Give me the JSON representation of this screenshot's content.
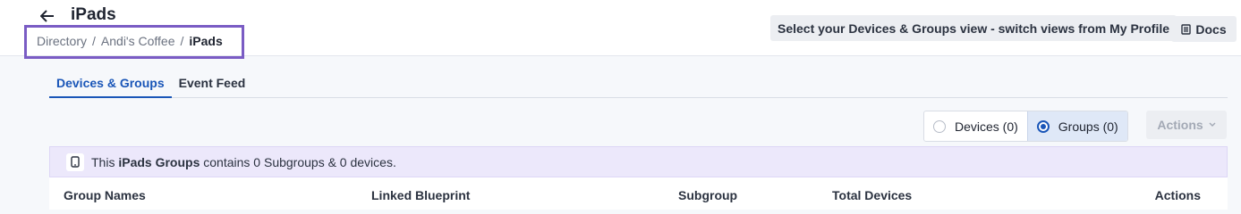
{
  "header": {
    "title": "iPads",
    "breadcrumb": [
      "Directory",
      "Andi's Coffee",
      "iPads"
    ],
    "view_hint": "Select your Devices & Groups view - switch views from My Profile",
    "docs_label": "Docs"
  },
  "tabs": [
    {
      "label": "Devices & Groups",
      "active": true
    },
    {
      "label": "Event Feed",
      "active": false
    }
  ],
  "view_toggle": {
    "devices_label": "Devices (0)",
    "groups_label": "Groups (0)",
    "selected": "groups"
  },
  "actions_label": "Actions",
  "banner": {
    "prefix": "This",
    "group_name": "iPads Groups",
    "suffix": "contains 0 Subgroups & 0 devices."
  },
  "table": {
    "columns": [
      "Group Names",
      "Linked Blueprint",
      "Subgroup",
      "Total Devices",
      "Actions"
    ]
  },
  "colors": {
    "accent": "#1a56b8",
    "highlight_box": "#7a5cc4",
    "banner_bg": "#ece8fb"
  }
}
